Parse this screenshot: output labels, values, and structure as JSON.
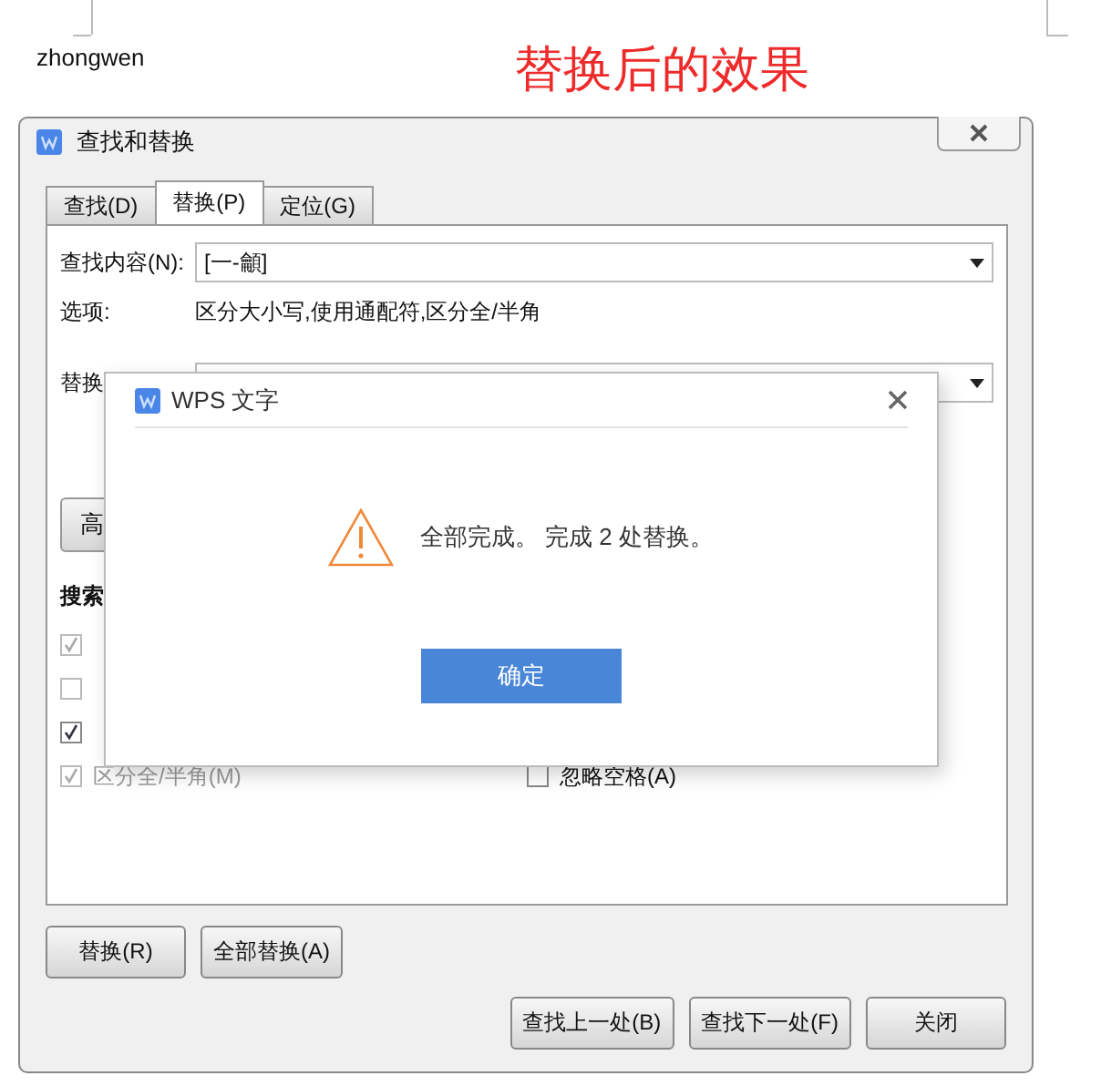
{
  "document": {
    "text": "zhongwen",
    "heading": "替换后的效果"
  },
  "dialog": {
    "title": "查找和替换",
    "tabs": [
      {
        "label": "查找(D)",
        "selected": false
      },
      {
        "label": "替换(P)",
        "selected": true
      },
      {
        "label": "定位(G)",
        "selected": false
      }
    ],
    "find": {
      "label": "查找内容(N):",
      "value": "[一-龥]"
    },
    "options": {
      "label": "选项:",
      "value": "区分大小写,使用通配符,区分全/半角"
    },
    "replace": {
      "label": "替换"
    },
    "more_button": "高",
    "search_label": "搜索",
    "checkbox_rows": [
      {
        "left": {
          "checked": true,
          "disabled": true
        }
      },
      {
        "left": {
          "checked": false,
          "disabled": true
        }
      },
      {
        "left": {
          "checked": true,
          "disabled": false
        }
      },
      {
        "left": {
          "label": "区分全/半角(M)",
          "checked": true,
          "disabled": true
        },
        "right": {
          "label": "忽略空格(A)",
          "checked": false,
          "disabled": false
        }
      }
    ],
    "buttons": [
      "替换(R)",
      "全部替换(A)"
    ],
    "bottom_buttons": [
      "查找上一处(B)",
      "查找下一处(F)",
      "关闭"
    ]
  },
  "message": {
    "title": "WPS 文字",
    "text": "全部完成。 完成 2 处替换。",
    "ok": "确定"
  }
}
